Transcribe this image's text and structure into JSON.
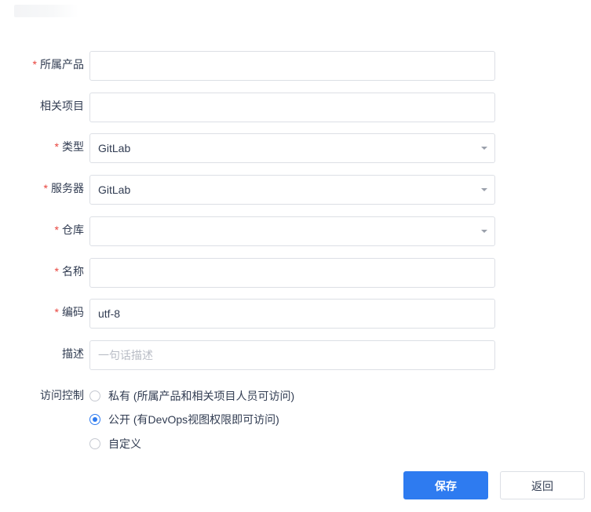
{
  "form": {
    "fields": [
      {
        "label": "所属产品",
        "required": true,
        "value": "",
        "placeholder": "",
        "type": "text"
      },
      {
        "label": "相关项目",
        "required": false,
        "value": "",
        "placeholder": "",
        "type": "text"
      },
      {
        "label": "类型",
        "required": true,
        "value": "GitLab",
        "placeholder": "",
        "type": "select"
      },
      {
        "label": "服务器",
        "required": true,
        "value": "GitLab",
        "placeholder": "",
        "type": "select"
      },
      {
        "label": "仓库",
        "required": true,
        "value": "",
        "placeholder": "",
        "type": "select"
      },
      {
        "label": "名称",
        "required": true,
        "value": "",
        "placeholder": "",
        "type": "text"
      },
      {
        "label": "编码",
        "required": true,
        "value": "utf-8",
        "placeholder": "",
        "type": "text"
      },
      {
        "label": "描述",
        "required": false,
        "value": "",
        "placeholder": "一句话描述",
        "type": "text"
      }
    ],
    "required_mark": "*",
    "access": {
      "label": "访问控制",
      "options": [
        {
          "label": "私有 (所属产品和相关项目人员可访问)",
          "checked": false
        },
        {
          "label": "公开 (有DevOps视图权限即可访问)",
          "checked": true
        },
        {
          "label": "自定义",
          "checked": false
        }
      ]
    },
    "save_label": "保存",
    "back_label": "返回"
  },
  "colors": {
    "accent": "#2e7bf0",
    "required": "#e8433c",
    "border": "#dcdfe5",
    "text": "#313c52",
    "placeholder": "#b8bcc5"
  },
  "icons": {
    "select_caret": "chevron-down-icon"
  }
}
